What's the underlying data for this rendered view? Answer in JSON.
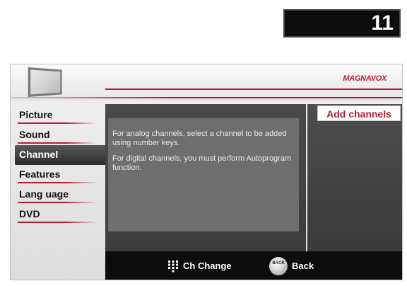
{
  "channel_display": "11",
  "brand": "MAGNAVOX",
  "menu": {
    "items": [
      {
        "label": "Picture",
        "selected": false
      },
      {
        "label": "Sound",
        "selected": false
      },
      {
        "label": "Channel",
        "selected": true
      },
      {
        "label": "Features",
        "selected": false
      },
      {
        "label": "Lang uage",
        "selected": false
      },
      {
        "label": "DVD",
        "selected": false
      }
    ]
  },
  "message": {
    "line1": "For analog channels, select a channel to be added using number keys.",
    "line2": "For digital channels, you must perform Autoprogram function."
  },
  "submenu": {
    "selected_label": "Add channels"
  },
  "bottom_bar": {
    "ch_change_label": "Ch Change",
    "back_label": "Back",
    "back_icon_text": "BACK"
  },
  "icons": {
    "tv": "tv-icon",
    "keypad": "keypad-icon",
    "back": "back-button-icon"
  },
  "colors": {
    "accent": "#b51c36",
    "panel": "#3c3c3c",
    "message_box": "#6e6e6e"
  }
}
